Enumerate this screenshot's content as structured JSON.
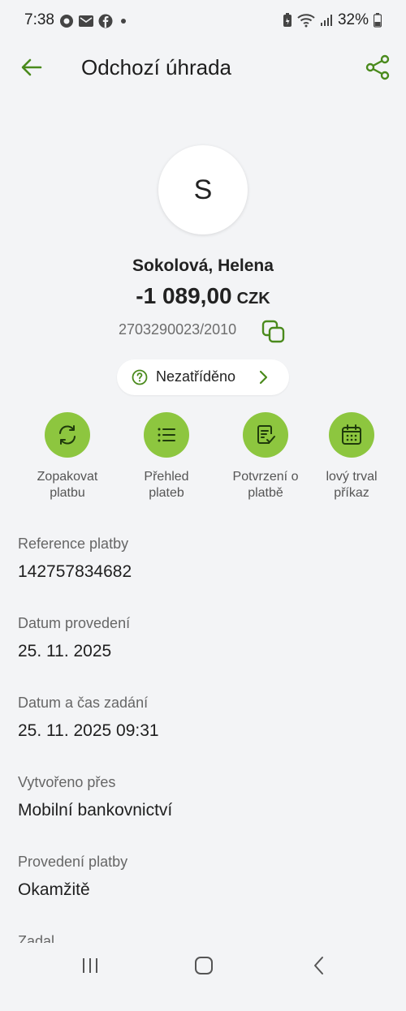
{
  "status_bar": {
    "time": "7:38",
    "battery_percent": "32%",
    "left_icons": [
      "chrome-icon",
      "mail-icon",
      "facebook-icon",
      "dot-icon"
    ],
    "right_icons": [
      "battery-saver-icon",
      "wifi-icon",
      "signal-icon",
      "battery-icon"
    ]
  },
  "header": {
    "title": "Odchozí úhrada",
    "back_icon": "arrow-left-icon",
    "share_icon": "share-icon"
  },
  "payment": {
    "avatar_initial": "S",
    "payee": "Sokolová, Helena",
    "amount": "-1 089,00",
    "currency": "CZK",
    "account": "2703290023/2010"
  },
  "category": {
    "label": "Nezatříděno"
  },
  "actions": [
    {
      "label": "Zopakovat\nplatbu",
      "icon": "repeat-icon"
    },
    {
      "label": "Přehled\nplateb",
      "icon": "list-icon"
    },
    {
      "label": "Potvrzení o\nplatbě",
      "icon": "document-check-icon"
    },
    {
      "label": "lový trval\npříkaz",
      "icon": "calendar-icon"
    }
  ],
  "details": [
    {
      "label": "Reference platby",
      "value": "142757834682"
    },
    {
      "label": "Datum provedení",
      "value": "25. 11. 2025"
    },
    {
      "label": "Datum a čas zadání",
      "value": "25. 11. 2025 09:31"
    },
    {
      "label": "Vytvořeno přes",
      "value": "Mobilní bankovnictví"
    },
    {
      "label": "Provedení platby",
      "value": "Okamžitě"
    },
    {
      "label": "Zadal",
      "value": ""
    }
  ],
  "colors": {
    "accent": "#4a8a1c",
    "action_circle": "#8dc63f",
    "background": "#f3f4f6"
  }
}
